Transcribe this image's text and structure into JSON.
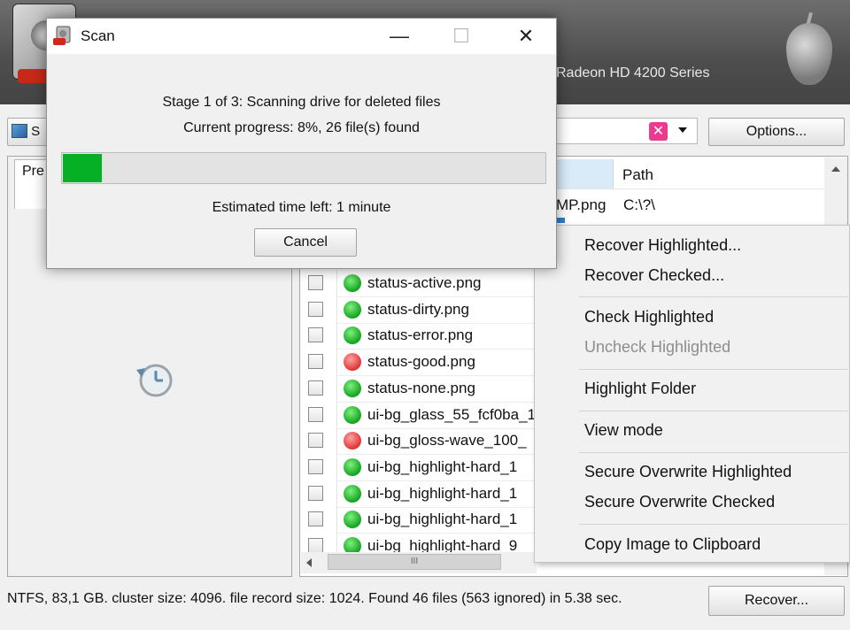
{
  "header": {
    "system_info": "Radeon HD 4200 Series"
  },
  "toolbar": {
    "drive_label_fragment": "S",
    "clear_filter_glyph": "✕",
    "options_label": "Options..."
  },
  "preview": {
    "tab_label_fragment": "Pre"
  },
  "file_list": {
    "columns": {
      "path": "Path"
    },
    "partial_row": {
      "name_fragment": "MP.png",
      "path": "C:\\?\\"
    },
    "rows": [
      {
        "name": "status-active.png",
        "status": "good"
      },
      {
        "name": "status-dirty.png",
        "status": "good"
      },
      {
        "name": "status-error.png",
        "status": "good"
      },
      {
        "name": "status-good.png",
        "status": "bad"
      },
      {
        "name": "status-none.png",
        "status": "good"
      },
      {
        "name": "ui-bg_glass_55_fcf0ba_1",
        "status": "good"
      },
      {
        "name": "ui-bg_gloss-wave_100_",
        "status": "bad"
      },
      {
        "name": "ui-bg_highlight-hard_1",
        "status": "good"
      },
      {
        "name": "ui-bg_highlight-hard_1",
        "status": "good"
      },
      {
        "name": "ui-bg_highlight-hard_1",
        "status": "good"
      },
      {
        "name": "ui-bg_highlight-hard_9",
        "status": "good"
      }
    ],
    "hscroll_grip": "III"
  },
  "status_bar": {
    "text": "NTFS, 83,1 GB. cluster size: 4096. file record size: 1024. Found 46 files (563 ignored) in 5.38 sec."
  },
  "recover_button": "Recover...",
  "context_menu": {
    "items": [
      {
        "label": "Recover Highlighted...",
        "enabled": true
      },
      {
        "label": "Recover Checked...",
        "enabled": true
      },
      {
        "label": "Check Highlighted",
        "enabled": true
      },
      {
        "label": "Uncheck Highlighted",
        "enabled": false
      },
      {
        "label": "Highlight Folder",
        "enabled": true
      },
      {
        "label": "View mode",
        "enabled": true
      },
      {
        "label": "Secure Overwrite Highlighted",
        "enabled": true
      },
      {
        "label": "Secure Overwrite Checked",
        "enabled": true
      },
      {
        "label": "Copy Image to Clipboard",
        "enabled": true
      }
    ]
  },
  "scan_dialog": {
    "title": "Scan",
    "stage_text": "Stage 1 of 3: Scanning drive for deleted files",
    "progress_text": "Current progress: 8%, 26 file(s) found",
    "progress_percent": 8,
    "eta_text": "Estimated time left: 1 minute",
    "cancel_label": "Cancel",
    "minimize_glyph": "—",
    "maximize_glyph": "☐",
    "close_glyph": "✕"
  },
  "colors": {
    "progress_fill": "#06b025",
    "status_good": "#14a31f",
    "status_bad": "#de3535",
    "clear_filter": "#ec3a8f"
  }
}
